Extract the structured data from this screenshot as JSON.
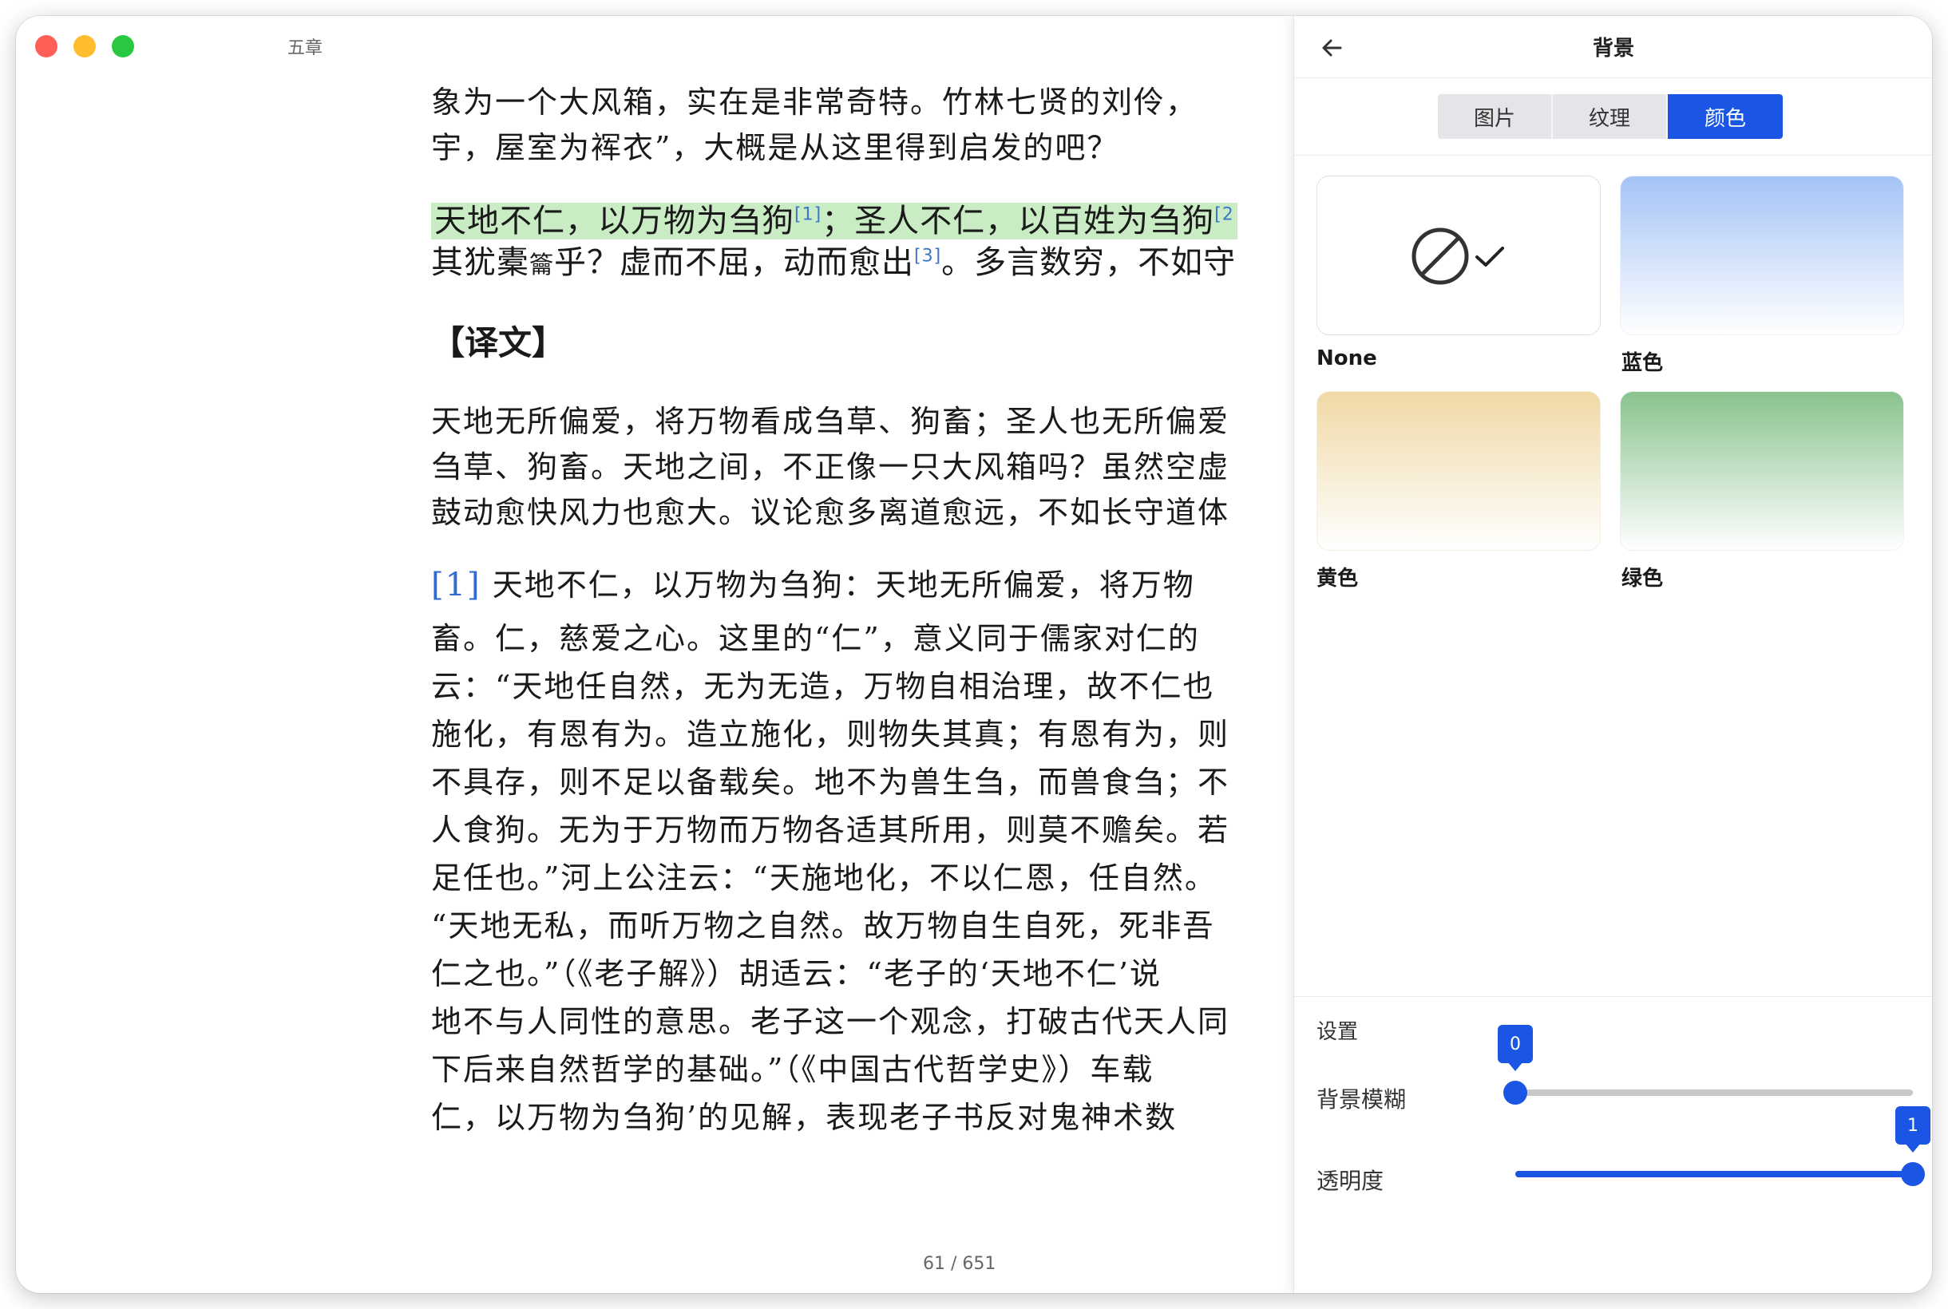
{
  "window": {
    "title": "五章"
  },
  "reader": {
    "lines_top": [
      "象为一个大风箱，实在是非常奇特。竹林七贤的刘伶，",
      "宇，屋室为裈衣”，大概是从这里得到启发的吧？"
    ],
    "highlight": {
      "part1": "天地不仁，以万物为刍狗",
      "fn1": "[1]",
      "part2": "；圣人不仁，以百姓为刍狗",
      "fn2": "[2"
    },
    "second_line": {
      "part1": "其犹橐",
      "small": "籥",
      "part2": "乎？虚而不屈，动而愈出",
      "fn3": "[3]",
      "part3": "。多言数穷，不如守"
    },
    "heading": "【译文】",
    "translation": [
      "天地无所偏爱，将万物看成刍草、狗畜；圣人也无所偏爱",
      "刍草、狗畜。天地之间，不正像一只大风箱吗？虽然空虚",
      "鼓动愈快风力也愈大。议论愈多离道愈远，不如长守道体"
    ],
    "note": {
      "marker": "[1]",
      "lines": [
        "天地不仁，以万物为刍狗：天地无所偏爱，将万物",
        "畜。仁，慈爱之心。这里的“仁”，意义同于儒家对仁的",
        "云：“天地任自然，无为无造，万物自相治理，故不仁也",
        "施化，有恩有为。造立施化，则物失其真；有恩有为，则",
        "不具存，则不足以备载矣。地不为兽生刍，而兽食刍；不",
        "人食狗。无为于万物而万物各适其所用，则莫不赡矣。若",
        "足任也。”河上公注云：“天施地化，不以仁恩，任自然。",
        "“天地无私，而听万物之自然。故万物自生自死，死非吾",
        "仁之也。”（《老子解》）胡适云：“老子的‘天地不仁’说",
        "地不与人同性的意思。老子这一个观念，打破古代天人同",
        "下后来自然哲学的基础。”（《中国古代哲学史》）车载",
        "仁，以万物为刍狗’的见解，表现老子书反对鬼神术数"
      ]
    },
    "page_indicator": "61 / 651"
  },
  "panel": {
    "title": "背景",
    "tabs": [
      {
        "label": "图片",
        "active": false
      },
      {
        "label": "纹理",
        "active": false
      },
      {
        "label": "颜色",
        "active": true
      }
    ],
    "swatches": [
      {
        "label": "None",
        "selected": true
      },
      {
        "label": "蓝色",
        "color": "#a4c3f6"
      },
      {
        "label": "黄色",
        "color": "#f0d9a6"
      },
      {
        "label": "绿色",
        "color": "#89c38e"
      }
    ],
    "settings": {
      "title": "设置",
      "blur": {
        "label": "背景模糊",
        "value": "0",
        "fraction": 0
      },
      "opacity": {
        "label": "透明度",
        "value": "1",
        "fraction": 1
      }
    },
    "accent": "#1a55e3"
  }
}
